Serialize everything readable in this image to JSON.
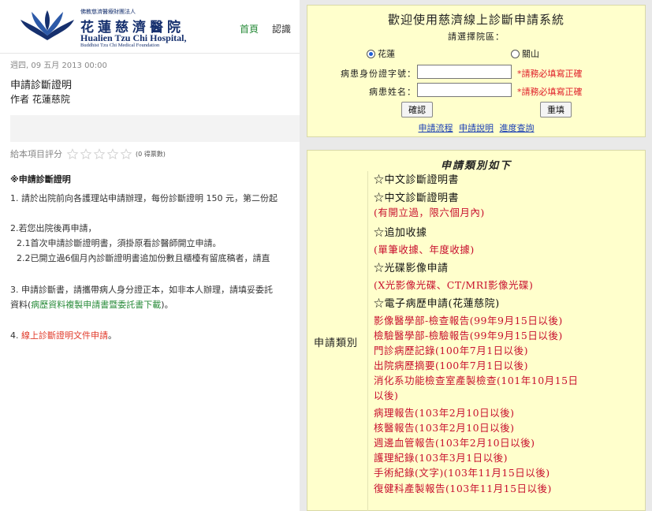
{
  "header": {
    "logo_small": "佛教慈濟醫療財團法人",
    "logo_name": "花蓮慈濟醫院",
    "logo_en": "Hualien Tzu Chi Hospital,",
    "logo_en2": "Buddhist Tzu Chi Medical Foundation",
    "nav_home": "首頁",
    "nav_about": "認識"
  },
  "article": {
    "date": "週四, 09 五月 2013 00:00",
    "title": "申請診斷證明",
    "author": "作者 花蓮慈院",
    "rating_label": "給本項目評分",
    "rating_count": "(0 得票數)",
    "rating_value": 0,
    "rating_max": 5,
    "section_head": "※申請診斷證明",
    "item1": "1. 請於出院前向各護理站申請辦理，每份診斷證明 150 元，第二份起",
    "item2": "2.若您出院後再申請，",
    "item2_1": "2.1首次申請診斷證明書，須掛原看診醫師開立申請。",
    "item2_2": "2.2已開立過6個月內診斷證明書追加份數且櫃檯有留底稿者，請直",
    "item3": "3. 申請診斷書，請攜帶病人身分證正本，如非本人辦理，請填妥委託",
    "item3_b_pre": "資料(",
    "item3_b_link": "病歷資料複製申請書暨委託書下載",
    "item3_b_post": ")。",
    "item4_pre": "4. ",
    "item4_link": "線上診斷證明文件申請",
    "item4_post": "。"
  },
  "form": {
    "title": "歡迎使用慈濟線上診斷申請系統",
    "choose_label": "請選擇院區：",
    "campus_options": [
      "花蓮",
      "關山"
    ],
    "campus_selected": "花蓮",
    "id_label": "病患身份證字號：",
    "id_value": "",
    "name_label": "病患姓名：",
    "name_value": "",
    "required_note": "*請務必填寫正確",
    "confirm_button": "確認",
    "reset_button": "重填",
    "links": [
      "申請流程",
      "申請說明",
      "進度查詢"
    ]
  },
  "categories": {
    "title": "申請類別如下",
    "label": "申請類別",
    "items": [
      {
        "text": "☆中文診斷證明書",
        "style": "h"
      },
      {
        "text": "☆中文診斷證明書",
        "style": "h"
      },
      {
        "text": "(有開立過，限六個月內)",
        "style": "s"
      },
      {
        "text": "☆追加收據",
        "style": "h"
      },
      {
        "text": "(單筆收據、年度收據)",
        "style": "s"
      },
      {
        "text": "☆光碟影像申請",
        "style": "h"
      },
      {
        "text": "(X光影像光碟、CT/MRI影像光碟)",
        "style": "s"
      },
      {
        "text": "☆電子病歷申請(花蓮慈院)",
        "style": "h"
      },
      {
        "text": "影像醫學部-檢查報告(99年9月15日以後)",
        "style": "s"
      },
      {
        "text": "檢驗醫學部-檢驗報告(99年9月15日以後)",
        "style": "s"
      },
      {
        "text": "門診病歷記錄(100年7月1日以後)",
        "style": "s"
      },
      {
        "text": "出院病歷摘要(100年7月1日以後)",
        "style": "s"
      },
      {
        "text": "消化系功能檢查室產製檢查(101年10月15日",
        "style": "s"
      },
      {
        "text": "以後)",
        "style": "s"
      },
      {
        "text": "病理報告(103年2月10日以後)",
        "style": "s"
      },
      {
        "text": "核醫報告(103年2月10日以後)",
        "style": "s"
      },
      {
        "text": "週邊血管報告(103年2月10日以後)",
        "style": "s"
      },
      {
        "text": "護理紀錄(103年3月1日以後)",
        "style": "s"
      },
      {
        "text": "手術紀錄(文字)(103年11月15日以後)",
        "style": "s"
      },
      {
        "text": "復健科產製報告(103年11月15日以後)",
        "style": "s"
      }
    ]
  },
  "colors": {
    "panel_bg": "#ffffcc",
    "required_red": "#e0202a",
    "link_blue": "#1a3fb5",
    "site_green": "#2a8c3b",
    "brand_navy": "#16306e"
  }
}
